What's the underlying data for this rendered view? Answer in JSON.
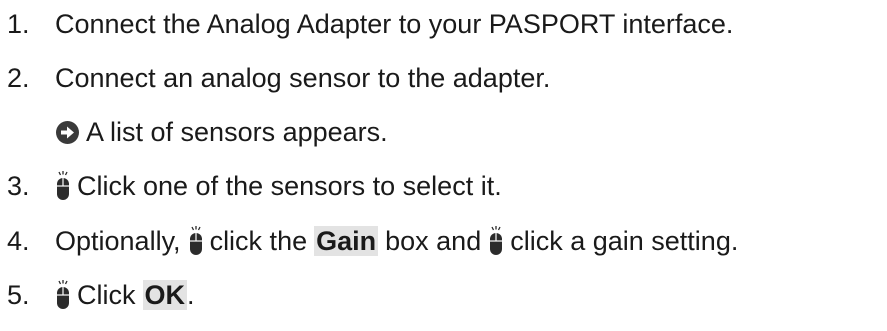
{
  "steps": [
    {
      "number": "1.",
      "text": "Connect the Analog Adapter to your PASPORT interface."
    },
    {
      "number": "2.",
      "text": "Connect an analog sensor to the adapter."
    },
    {
      "result_text": "A list of sensors appears.",
      "result_icon": "arrow-right-circle-icon"
    },
    {
      "number": "3.",
      "text": "Click one of the sensors to select it.",
      "icon": "mouse-click-icon"
    },
    {
      "number": "4.",
      "text_a": "Optionally,",
      "text_b": "click the",
      "term_gain": "Gain",
      "text_c": "box and",
      "text_d": "click a gain setting.",
      "icon": "mouse-click-icon"
    },
    {
      "number": "5.",
      "text": "Click",
      "term_ok": "OK",
      "end": ".",
      "icon": "mouse-click-icon"
    }
  ],
  "colors": {
    "text": "#1a1a1a",
    "term_highlight": "#e3e3e3",
    "icon": "#2b2b2b"
  }
}
